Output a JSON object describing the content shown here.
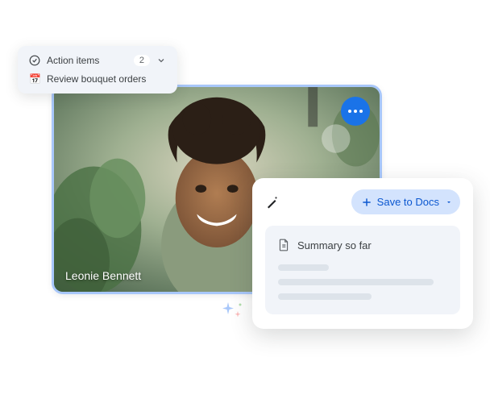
{
  "video": {
    "participant_name": "Leonie Bennett"
  },
  "action_items": {
    "title": "Action items",
    "count": "2",
    "items": [
      {
        "icon": "📅",
        "label": "Review bouquet orders"
      }
    ]
  },
  "summary": {
    "save_button": "Save to Docs",
    "title": "Summary so far"
  }
}
